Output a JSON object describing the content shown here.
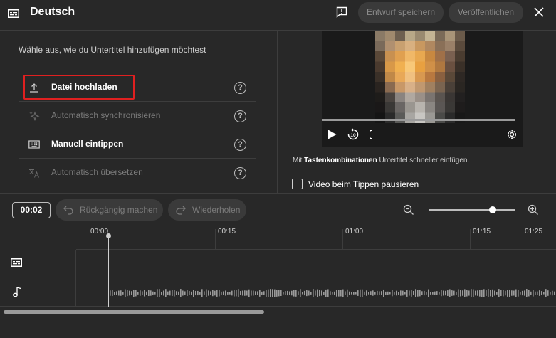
{
  "header": {
    "title": "Deutsch",
    "save_label": "Entwurf speichern",
    "publish_label": "Veröffentlichen"
  },
  "left": {
    "prompt": "Wähle aus, wie du Untertitel hinzufügen möchtest",
    "options": [
      {
        "label": "Datei hochladen",
        "icon": "upload-icon",
        "enabled": true
      },
      {
        "label": "Automatisch synchronisieren",
        "icon": "sparkle-icon",
        "enabled": false
      },
      {
        "label": "Manuell eintippen",
        "icon": "keyboard-icon",
        "enabled": true
      },
      {
        "label": "Automatisch übersetzen",
        "icon": "translate-icon",
        "enabled": false
      }
    ],
    "help_glyph": "?"
  },
  "right": {
    "shortcut_prefix": "Mit ",
    "shortcut_bold": "Tastenkombinationen",
    "shortcut_suffix": " Untertitel schneller einfügen.",
    "pause_label": "Video beim Tippen pausieren"
  },
  "toolbar": {
    "time": "00:02",
    "undo_label": "Rückgängig machen",
    "redo_label": "Wiederholen"
  },
  "timeline": {
    "ticks": [
      "00:00",
      "00:15",
      "01:00",
      "01:15",
      "01:25"
    ]
  },
  "colors": {
    "background": "#282828",
    "highlight": "#e02020",
    "disabled_text": "#7a7a7a"
  }
}
